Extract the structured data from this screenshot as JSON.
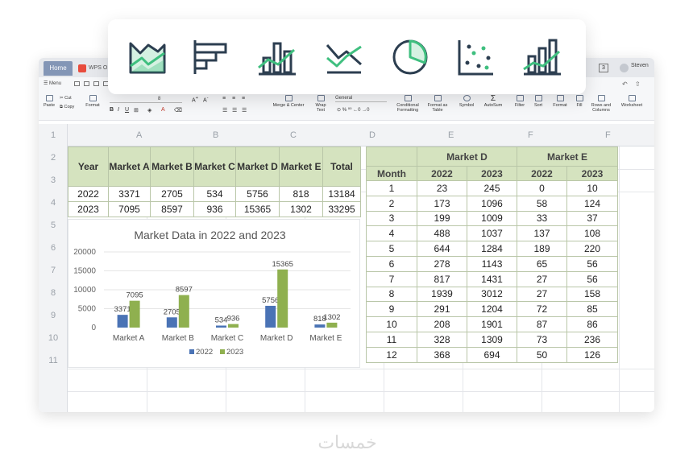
{
  "window": {
    "tabs": [
      {
        "label": "Home"
      },
      {
        "label": "WPS O"
      }
    ],
    "badge_count": "3",
    "username": "Steven"
  },
  "menubar": {
    "menu_label": "Menu"
  },
  "ribbon": {
    "paste": "Paste",
    "cut": "Cut",
    "copy": "Copy",
    "format": "Format",
    "font_size": "8",
    "merge_center": "Merge & Center",
    "wrap_text_1": "Wrap",
    "wrap_text_2": "Text",
    "number_format": "General",
    "conditional_1": "Conditional",
    "conditional_2": "Formatting",
    "format_table_1": "Format as",
    "format_table_2": "Table",
    "symbol": "Symbol",
    "autosum": "AutoSum",
    "filter": "Filter",
    "sort": "Sort",
    "format_btn": "Format",
    "fill": "Fill",
    "rows_cols_1": "Rows and",
    "rows_cols_2": "Columns",
    "worksheet": "Worksheet"
  },
  "sheet": {
    "row_headers": [
      "1",
      "2",
      "3",
      "4",
      "5",
      "6",
      "7",
      "8",
      "9",
      "10",
      "11"
    ],
    "col_headers": [
      "A",
      "B",
      "C",
      "D",
      "E",
      "F",
      "F"
    ]
  },
  "left_table": {
    "headers": [
      "Year",
      "Market A",
      "Market B",
      "Market C",
      "Market D",
      "Market E",
      "Total"
    ],
    "rows": [
      [
        "2022",
        "3371",
        "2705",
        "534",
        "5756",
        "818",
        "13184"
      ],
      [
        "2023",
        "7095",
        "8597",
        "936",
        "15365",
        "1302",
        "33295"
      ]
    ]
  },
  "right_table": {
    "group_d": "Market D",
    "group_e": "Market E",
    "month_label": "Month",
    "sub_headers": [
      "2022",
      "2023",
      "2022",
      "2023"
    ],
    "rows": [
      [
        "1",
        "23",
        "245",
        "0",
        "10"
      ],
      [
        "2",
        "173",
        "1096",
        "58",
        "124"
      ],
      [
        "3",
        "199",
        "1009",
        "33",
        "37"
      ],
      [
        "4",
        "488",
        "1037",
        "137",
        "108"
      ],
      [
        "5",
        "644",
        "1284",
        "189",
        "220"
      ],
      [
        "6",
        "278",
        "1143",
        "65",
        "56"
      ],
      [
        "7",
        "817",
        "1431",
        "27",
        "56"
      ],
      [
        "8",
        "1939",
        "3012",
        "27",
        "158"
      ],
      [
        "9",
        "291",
        "1204",
        "72",
        "85"
      ],
      [
        "10",
        "208",
        "1901",
        "87",
        "86"
      ],
      [
        "11",
        "328",
        "1309",
        "73",
        "236"
      ],
      [
        "12",
        "368",
        "694",
        "50",
        "126"
      ]
    ]
  },
  "chart_data": {
    "type": "bar",
    "title": "Market Data in 2022 and 2023",
    "categories": [
      "Market A",
      "Market B",
      "Market C",
      "Market D",
      "Market E"
    ],
    "series": [
      {
        "name": "2022",
        "values": [
          3371,
          2705,
          534,
          5756,
          818
        ],
        "color": "#4a73b5"
      },
      {
        "name": "2023",
        "values": [
          7095,
          8597,
          936,
          15365,
          1302
        ],
        "color": "#8fb04f"
      }
    ],
    "yticks": [
      0,
      5000,
      10000,
      15000,
      20000
    ],
    "ylim": [
      0,
      20000
    ],
    "legend": "bottom",
    "grid": true
  },
  "toolbar_icons": [
    {
      "name": "area-chart-icon"
    },
    {
      "name": "horizontal-bar-chart-icon"
    },
    {
      "name": "combo-bar-line-chart-icon"
    },
    {
      "name": "line-chart-icon"
    },
    {
      "name": "pie-chart-icon"
    },
    {
      "name": "scatter-chart-icon"
    },
    {
      "name": "combo-column-line-chart-icon"
    }
  ],
  "colors": {
    "accent_green": "#3fbf7f",
    "icon_navy": "#2c3e50",
    "header_green": "#d5e3bf"
  },
  "watermark": "خمسات"
}
